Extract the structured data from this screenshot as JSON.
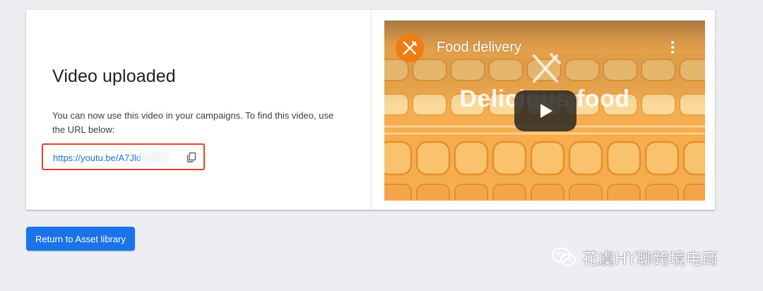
{
  "panel": {
    "title": "Video uploaded",
    "description": "You can now use this video in your campaigns. To find this video, use the URL below:",
    "video_url": "https://youtu.be/A7Jld     0",
    "copy_icon": "copy-icon",
    "highlight_color": "#e8402d"
  },
  "video_preview": {
    "channel_title": "Food delivery",
    "overlay_text": "Delicious food",
    "avatar_icon": "utensils-icon",
    "menu_icon": "more-vert-icon",
    "play_icon": "play-icon",
    "background_color": "#f7b658"
  },
  "actions": {
    "return_label": "Return to Asset library",
    "button_color": "#1a73e8"
  },
  "watermark": {
    "text": "花虞HY聊跨境电商",
    "icon": "wechat-icon"
  }
}
